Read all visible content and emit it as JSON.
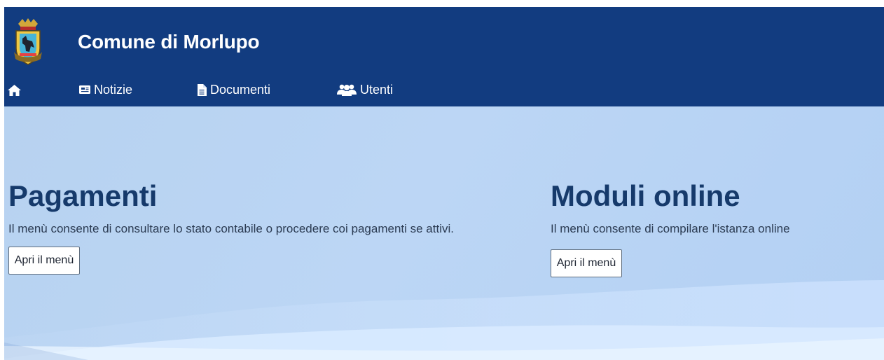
{
  "header": {
    "site_title": "Comune di Morlupo",
    "logo": {
      "icon": "municipal-coat-of-arms"
    }
  },
  "nav": {
    "home": {
      "icon": "home-icon"
    },
    "items": [
      {
        "label": "Notizie",
        "icon": "newspaper-icon"
      },
      {
        "label": "Documenti",
        "icon": "document-icon"
      },
      {
        "label": "Utenti",
        "icon": "users-icon"
      }
    ]
  },
  "cards": [
    {
      "title": "Pagamenti",
      "description": "Il menù consente di consultare lo stato contabile o procedere coi pagamenti se attivi.",
      "button": "Apri il menù"
    },
    {
      "title": "Moduli online",
      "description": "Il menù consente di compilare l'istanza online",
      "button": "Apri il menù"
    }
  ],
  "colors": {
    "header_bg": "#123c80",
    "hero_bg": "#b7d2f0",
    "title_text": "#163a6b"
  }
}
